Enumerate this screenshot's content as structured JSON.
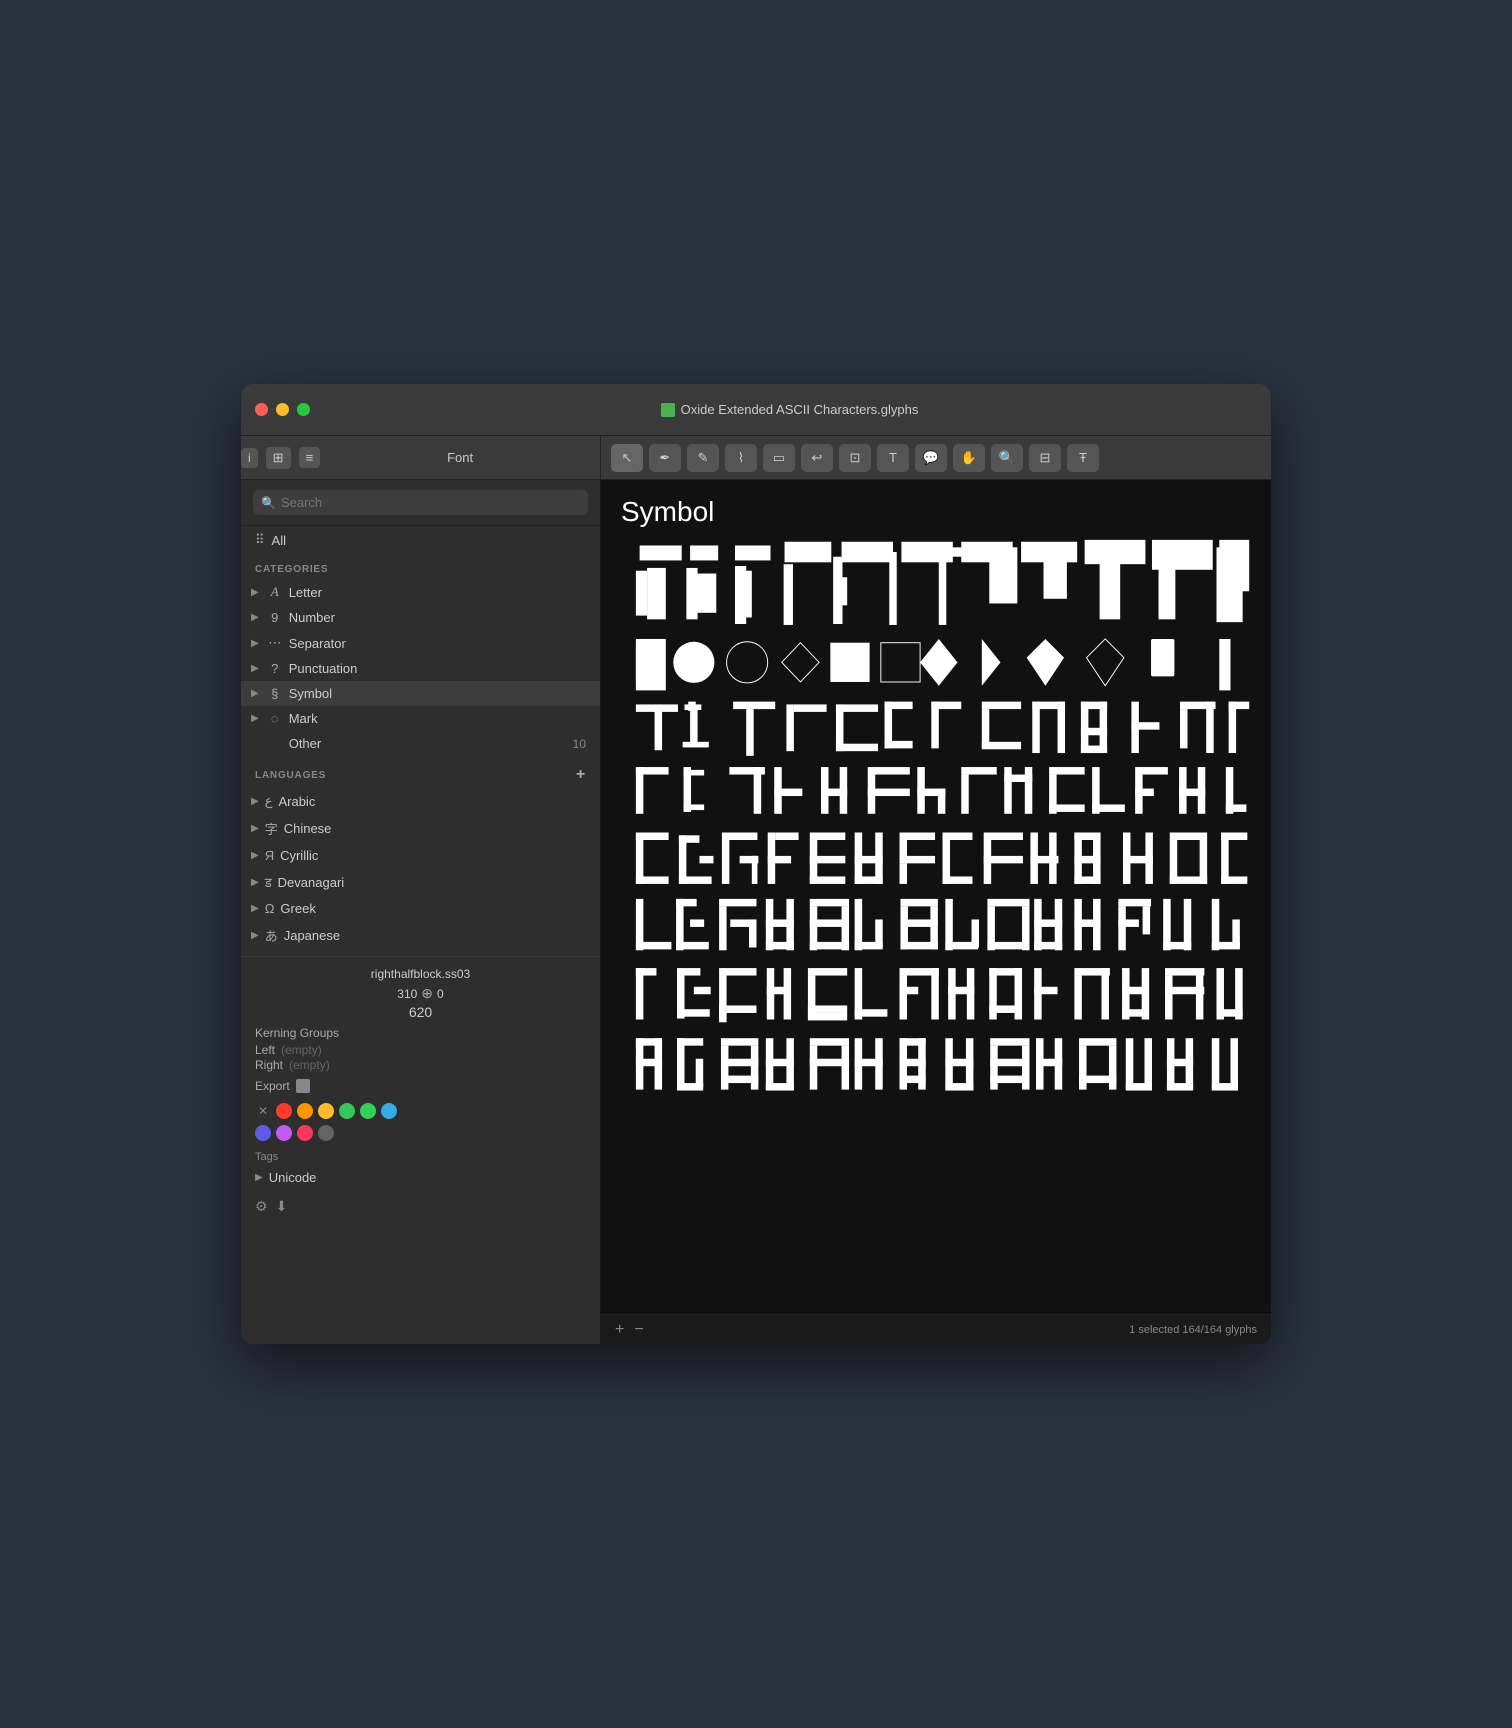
{
  "window": {
    "title": "Oxide Extended ASCII Characters.glyphs",
    "title_icon_color": "#4caf50"
  },
  "titlebar": {
    "traffic_lights": [
      "red",
      "yellow",
      "green"
    ]
  },
  "toolbar_left": {
    "label": "Font"
  },
  "toolbar_buttons": [
    {
      "icon": "i",
      "label": "info-button"
    },
    {
      "icon": "⊞",
      "label": "grid-button"
    },
    {
      "icon": "≡",
      "label": "list-button"
    }
  ],
  "toolbar_right_buttons": [
    "cursor",
    "pen",
    "pencil",
    "brush",
    "rect",
    "undo",
    "transform",
    "text",
    "speech",
    "hand",
    "zoom",
    "scale",
    "type"
  ],
  "sidebar": {
    "search_placeholder": "Search",
    "all_label": "All",
    "categories_label": "CATEGORIES",
    "categories": [
      {
        "icon": "A",
        "label": "Letter",
        "count": ""
      },
      {
        "icon": "9",
        "label": "Number",
        "count": ""
      },
      {
        "icon": "…",
        "label": "Separator",
        "count": ""
      },
      {
        "icon": "?",
        "label": "Punctuation",
        "count": ""
      },
      {
        "icon": "§",
        "label": "Symbol",
        "count": ""
      },
      {
        "icon": "◌",
        "label": "Mark",
        "count": ""
      },
      {
        "icon": "",
        "label": "Other",
        "count": "10"
      }
    ],
    "languages_label": "LANGUAGES",
    "languages": [
      {
        "icon": "ع",
        "label": "Arabic"
      },
      {
        "icon": "字",
        "label": "Chinese"
      },
      {
        "icon": "Я",
        "label": "Cyrillic"
      },
      {
        "icon": "ड",
        "label": "Devanagari"
      },
      {
        "icon": "Ω",
        "label": "Greek"
      },
      {
        "icon": "あ",
        "label": "Japanese"
      }
    ],
    "selected_glyph": {
      "name": "righthalfblock.ss03",
      "width": "310",
      "move_icon": "⊕",
      "move_value": "0",
      "height": "620",
      "kerning_label": "Kerning Groups",
      "left_label": "Left",
      "left_value": "(empty)",
      "right_label": "Right",
      "right_value": "(empty)",
      "export_label": "Export"
    },
    "colors": {
      "row1": [
        "#ff3b30",
        "#ff9500",
        "#34c759",
        "#ffcc00",
        "#30d158",
        "#32ade6"
      ],
      "row2": [
        "#5e5ce6",
        "#bf5af2",
        "#ff375f",
        "#636366"
      ]
    },
    "tags_label": "Tags",
    "tags": [
      {
        "icon": "▶",
        "label": "Unicode"
      }
    ]
  },
  "glyph_panel": {
    "category_title": "Symbol",
    "status_text": "1 selected 164/164 glyphs",
    "add_label": "+",
    "remove_label": "−"
  }
}
